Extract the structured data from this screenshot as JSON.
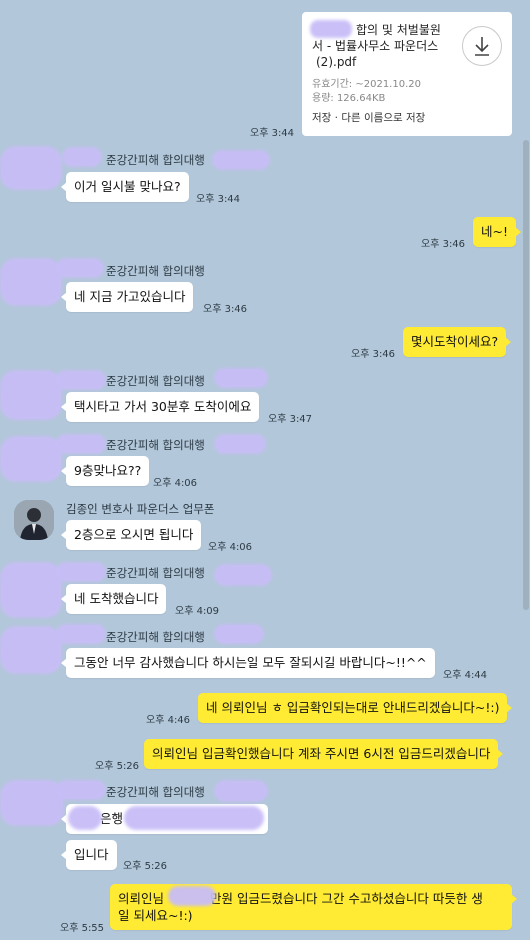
{
  "file": {
    "title_visible": "합의 및 처벌불원서 - 법률사무소 파운더스 (2).pdf",
    "title_line1": "합의 및 처벌불원",
    "title_line2": "서 - 법률사무소 파운더스",
    "title_line3": "(2).pdf",
    "expiry": "유효기간: ~2021.10.20",
    "size": "용량: 126.64KB",
    "action_save": "저장",
    "action_sep": "·",
    "action_save_as": "다른 이름으로 저장",
    "time": "오후 3:44"
  },
  "senders": {
    "group": "준강간피해 합의대행",
    "lawyer": "김종인 변호사 파운더스 업무폰"
  },
  "messages": [
    {
      "text": "이거 일시불 맞나요?",
      "time": "오후 3:44"
    },
    {
      "text": "네~!",
      "time": "오후 3:46"
    },
    {
      "text": "네 지금 가고있습니다",
      "time": "오후 3:46"
    },
    {
      "text": "몇시도착이세요?",
      "time": "오후 3:46"
    },
    {
      "text": "택시타고 가서 30분후 도착이에요",
      "time": "오후 3:47"
    },
    {
      "text": "9층맞나요??",
      "time": "오후 4:06"
    },
    {
      "text": "2층으로 오시면 됩니다",
      "time": "오후 4:06"
    },
    {
      "text": "네 도착했습니다",
      "time": "오후 4:09"
    },
    {
      "text": "그동안 너무 감사했습니다 하시는일 모두 잘되시길 바랍니다~!!^^",
      "time": "오후 4:44"
    },
    {
      "text": "네 의뢰인님 ㅎ 입금확인되는대로 안내드리겠습니다~!:)",
      "time": "오후 4:46"
    },
    {
      "text": "의뢰인님 입금확인했습니다 계좌 주시면 6시전 입금드리겠습니다",
      "time": "오후 5:26"
    },
    {
      "text": "은행",
      "time": ""
    },
    {
      "text": "입니다",
      "time": "오후 5:26"
    },
    {
      "text_line1": "의뢰인님",
      "text_line1b": "만원 입금드렸습니다 그간 수고하셨습니다 따듯한 생",
      "text_line2": "일 되세요~!:)",
      "time": "오후 5:55"
    }
  ],
  "colors": {
    "background": "#b2c7d9",
    "my_bubble": "#ffeb33",
    "their_bubble": "#ffffff",
    "redaction": "#c8bdf7"
  },
  "icons": {
    "download": "download-icon",
    "avatar": "profile-photo"
  }
}
